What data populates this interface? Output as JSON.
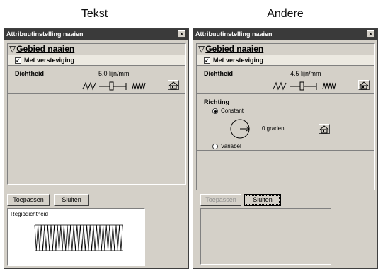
{
  "captions": {
    "left": "Tekst",
    "right": "Andere"
  },
  "window": {
    "title": "Attribuutinstelling naaien",
    "close_glyph": "×"
  },
  "section": {
    "collapse_glyph": "▽",
    "title": "Gebied naaien"
  },
  "checkbox": {
    "label": "Met versteviging",
    "checked": true,
    "check_glyph": "✓"
  },
  "density": {
    "label": "Dichtheid",
    "left_value": "5.0 lijn/mm",
    "right_value": "4.5 lijn/mm",
    "slider_left_fraction": 0.5,
    "slider_right_fraction": 0.5
  },
  "richting": {
    "label": "Richting",
    "constant_label": "Constant",
    "variabel_label": "Variabel",
    "selected": "Constant",
    "angle_text": "0 graden"
  },
  "buttons": {
    "apply": "Toepassen",
    "close": "Sluiten"
  },
  "preview": {
    "label": "Regiodichtheid"
  },
  "icons": {
    "low_density": "sparse-zigzag-icon",
    "high_density": "dense-zigzag-icon",
    "house": "house-icon",
    "direction": "direction-circle-icon"
  }
}
